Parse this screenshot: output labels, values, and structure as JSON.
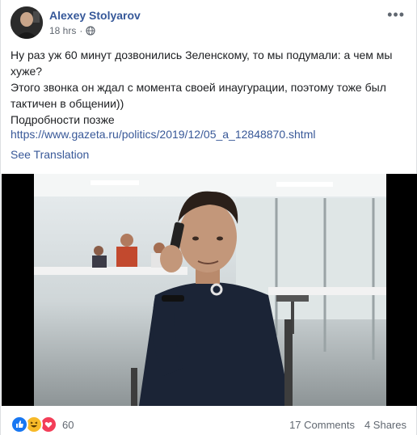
{
  "post": {
    "author": "Alexey Stolyarov",
    "time": "18 hrs",
    "privacy_icon": "globe-icon",
    "more_icon": "more-dots-icon",
    "text_lines": [
      "Ну раз уж 60 минут дозвонились Зеленскому, то мы подумали: а чем мы хуже?",
      "Этого звонка он ждал с момента своей инаугурации, поэтому тоже был тактичен в общении))",
      "Подробности позже"
    ],
    "link": "https://www.gazeta.ru/politics/2019/12/05_a_12848870.shtml",
    "see_translation": "See Translation"
  },
  "footer": {
    "reaction_icons": [
      "like-icon",
      "haha-icon",
      "love-icon"
    ],
    "reaction_count": "60",
    "comments": "17 Comments",
    "shares": "4 Shares"
  },
  "colors": {
    "link": "#385898",
    "author": "#365899",
    "meta": "#606770",
    "like": "#1877f2",
    "haha": "#f7b928",
    "love": "#f33e58"
  }
}
